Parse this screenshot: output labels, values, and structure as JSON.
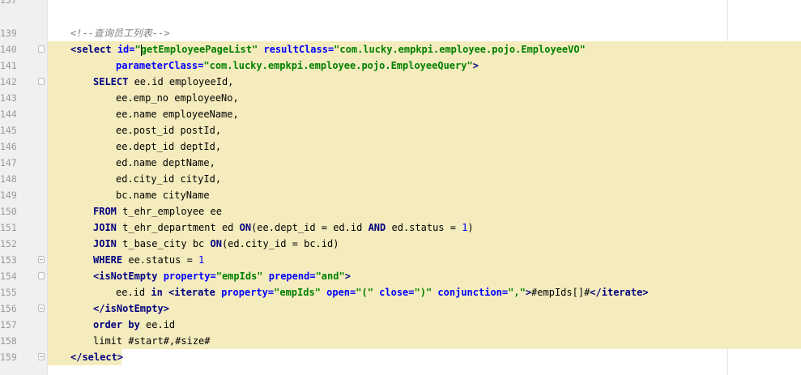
{
  "editor": {
    "line_numbers": [
      "137",
      "139",
      "140",
      "141",
      "142",
      "143",
      "144",
      "145",
      "146",
      "147",
      "148",
      "149",
      "150",
      "151",
      "152",
      "153",
      "154",
      "155",
      "156",
      "157",
      "158",
      "159"
    ],
    "comment": "<!--查询员工列表-->",
    "select_open": {
      "tag_open": "<select",
      "id_attr": "id=",
      "id_q1": "\"",
      "id_value": "getEmployeePageList",
      "id_q2": "\"",
      "result_attr": " resultClass=",
      "result_value": "\"com.lucky.empkpi.employee.pojo.EmployeeVO\""
    },
    "param": {
      "attr": "parameterClass=",
      "value": "\"com.lucky.empkpi.employee.pojo.EmployeeQuery\"",
      "close": ">"
    },
    "sql": {
      "select_kw": "SELECT",
      "select_rest": " ee.id employeeId,",
      "cols": [
        "ee.emp_no employeeNo,",
        "ee.name employeeName,",
        "ee.post_id postId,",
        "ee.dept_id deptId,",
        "ed.name deptName,",
        "ed.city_id cityId,",
        "bc.name cityName"
      ],
      "from_kw": "FROM",
      "from_rest": " t_ehr_employee ee",
      "join1_kw": "JOIN",
      "join1_a": " t_ehr_department ed ",
      "on_kw": "ON",
      "join1_b": "(ee.dept_id = ed.id ",
      "and_kw": "AND",
      "join1_c": " ed.status = ",
      "num1": "1",
      "join1_d": ")",
      "join2_kw": "JOIN",
      "join2_a": " t_base_city bc ",
      "on2_kw": "ON",
      "join2_b": "(ed.city_id = bc.id)",
      "where_kw": "WHERE",
      "where_rest": " ee.status = ",
      "num2": "1"
    },
    "isnotempty": {
      "tag": "<isNotEmpty",
      "prop_attr": " property=",
      "prop_val": "\"empIds\"",
      "prepend_attr": " prepend=",
      "prepend_val": "\"and\"",
      "close": ">"
    },
    "iterate": {
      "pre": "ee.id ",
      "in_kw": "in",
      "tag": " <iterate",
      "prop_attr": " property=",
      "prop_val": "\"empIds\"",
      "open_attr": " open=",
      "open_val": "\"(\"",
      "close_attr": " close=",
      "close_val": "\")\"",
      "conj_attr": " conjunction=",
      "conj_val": "\",\"",
      "gt": ">",
      "body": "#empIds[]#",
      "end_tag": "</iterate",
      "end_gt": ">"
    },
    "isnotempty_close": "</isNotEmpty>",
    "order": {
      "kw1": "order",
      "kw2": "by",
      "rest": " ee.id"
    },
    "limit": "limit #start#,#size#",
    "select_close": "</select>"
  }
}
